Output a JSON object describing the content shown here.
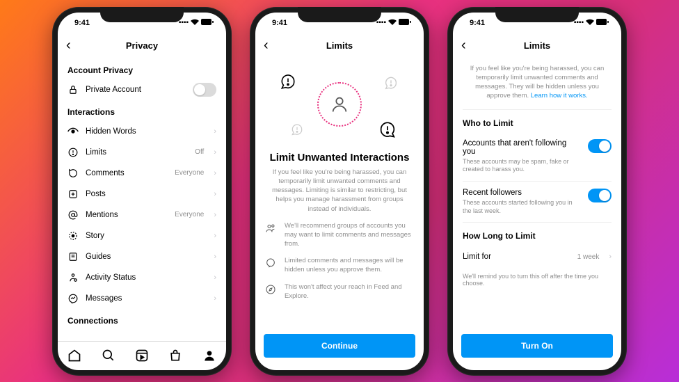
{
  "status": {
    "time": "9:41"
  },
  "phone1": {
    "title": "Privacy",
    "sections": {
      "account_privacy": "Account Privacy",
      "private_account": "Private Account",
      "interactions": "Interactions",
      "connections": "Connections"
    },
    "rows": {
      "hidden_words": {
        "label": "Hidden Words"
      },
      "limits": {
        "label": "Limits",
        "value": "Off"
      },
      "comments": {
        "label": "Comments",
        "value": "Everyone"
      },
      "posts": {
        "label": "Posts"
      },
      "mentions": {
        "label": "Mentions",
        "value": "Everyone"
      },
      "story": {
        "label": "Story"
      },
      "guides": {
        "label": "Guides"
      },
      "activity_status": {
        "label": "Activity Status"
      },
      "messages": {
        "label": "Messages"
      }
    }
  },
  "phone2": {
    "title": "Limits",
    "hero_title": "Limit Unwanted Interactions",
    "hero_desc": "If you feel like you're being harassed, you can temporarily limit unwanted comments and messages. Limiting is similar to restricting, but helps you manage harassment from groups instead of individuals.",
    "bullets": [
      "We'll recommend groups of accounts you may want to limit comments and messages from.",
      "Limited comments and messages will be hidden unless you approve them.",
      "This won't affect your reach in Feed and Explore."
    ],
    "cta": "Continue"
  },
  "phone3": {
    "title": "Limits",
    "intro": "If you feel like you're being harassed, you can temporarily limit unwanted comments and messages. They will be hidden unless you approve them.",
    "intro_link": "Learn how it works.",
    "who_heading": "Who to Limit",
    "opt1": {
      "title": "Accounts that aren't following you",
      "desc": "These accounts may be spam, fake or created to harass you."
    },
    "opt2": {
      "title": "Recent followers",
      "desc": "These accounts started following you in the last week."
    },
    "how_long_heading": "How Long to Limit",
    "limit_for_label": "Limit for",
    "limit_for_value": "1 week",
    "limit_note": "We'll remind you to turn this off after the time you choose.",
    "cta": "Turn On"
  }
}
